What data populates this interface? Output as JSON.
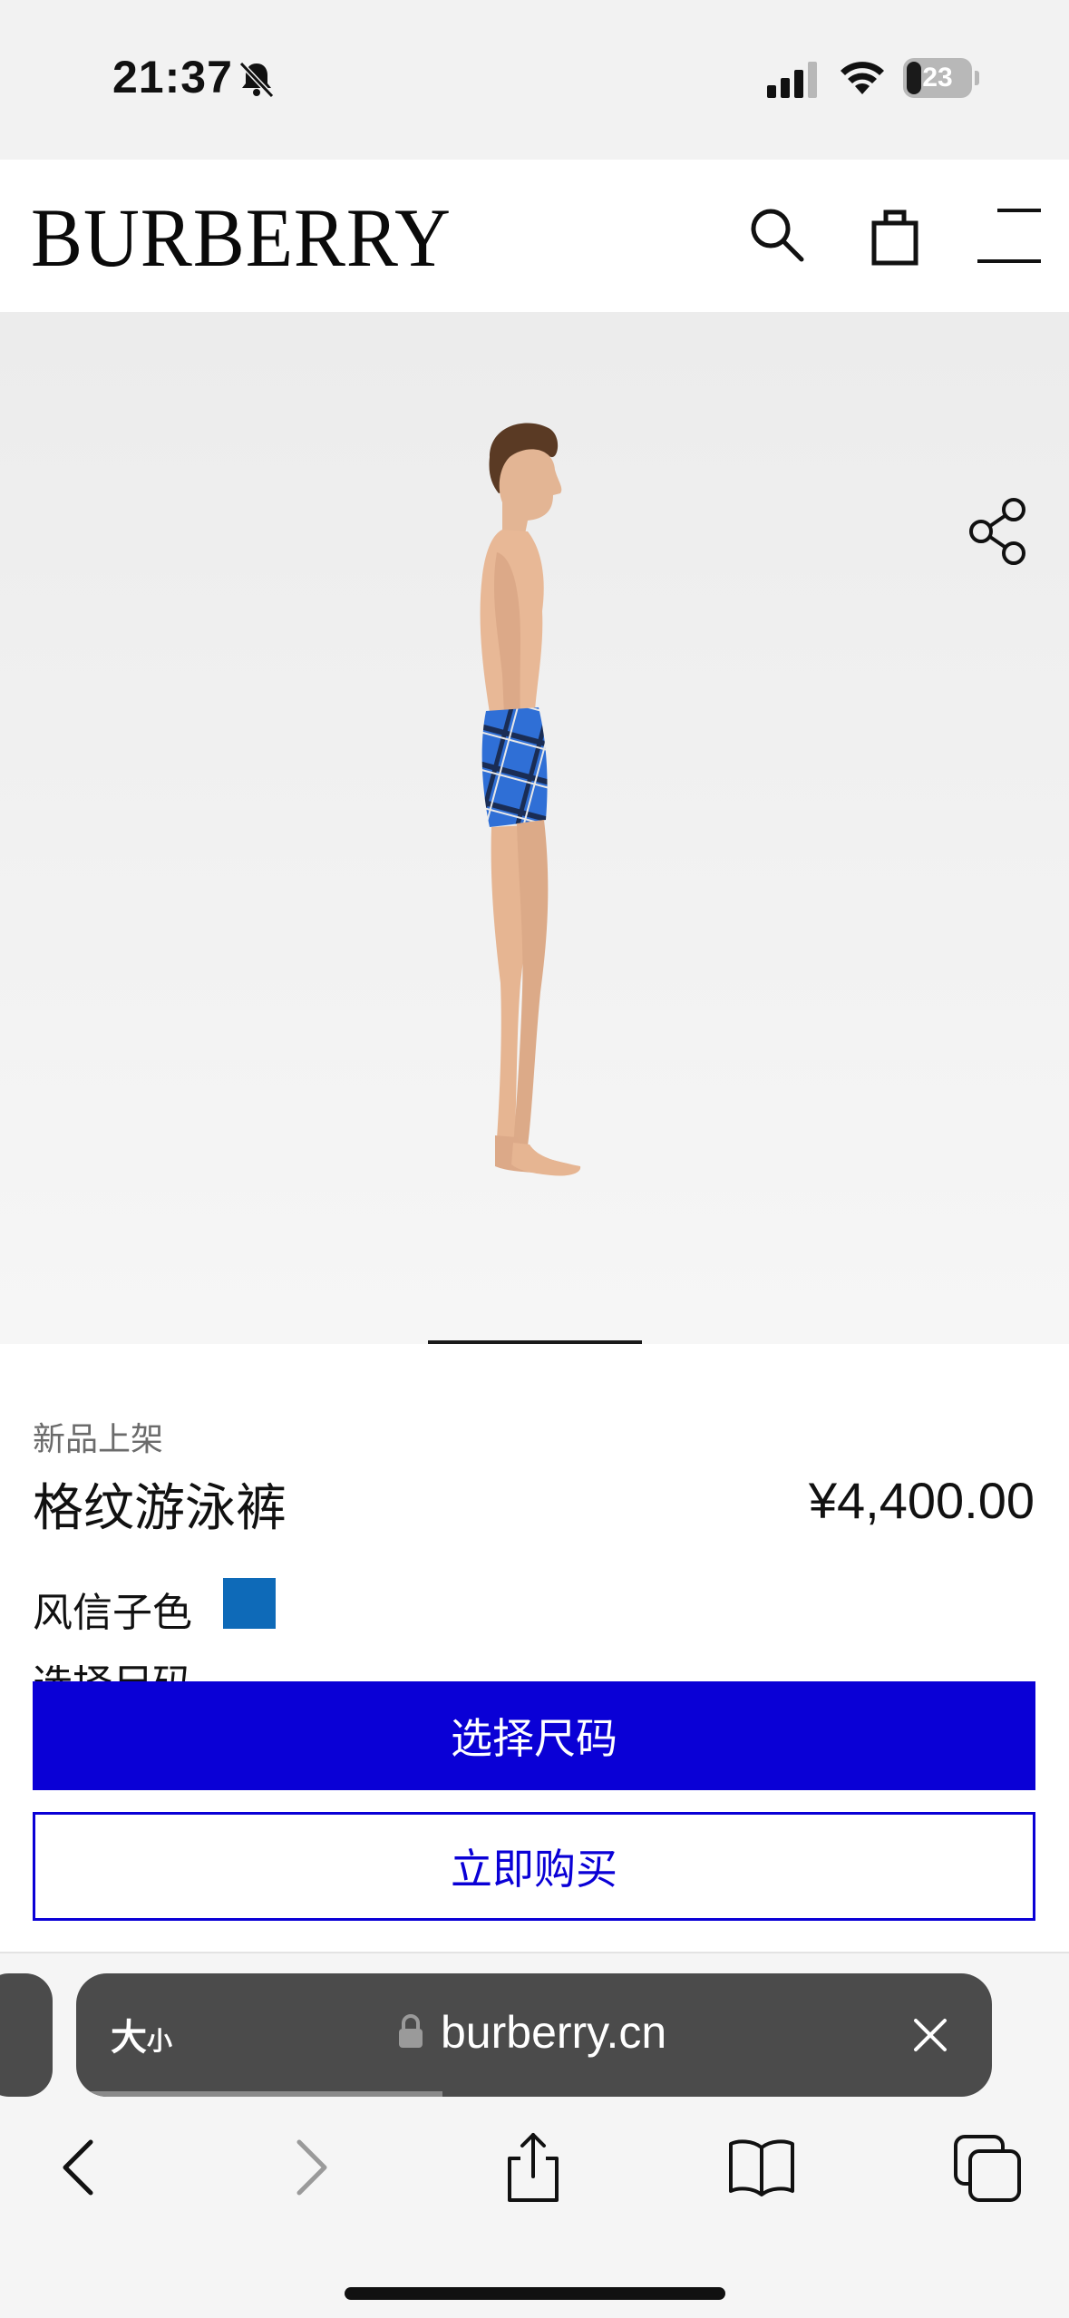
{
  "status_bar": {
    "time": "21:37",
    "battery": "23",
    "icons": [
      "bell-slash-icon",
      "cellular-signal-icon",
      "wifi-icon",
      "battery-icon"
    ]
  },
  "header": {
    "logo": "BURBERRY",
    "icons": [
      "search-icon",
      "shopping-bag-icon",
      "menu-icon"
    ]
  },
  "product_image": {
    "icons": [
      "share-icon"
    ],
    "swimwear_color": "#2f6fd6"
  },
  "product": {
    "badge": "新品上架",
    "name": "格纹游泳裤",
    "price": "¥4,400.00",
    "color_label": "风信子色",
    "swatch_color": "#0e6ab8",
    "size_label": "选择尺码"
  },
  "actions": {
    "select_size": "选择尺码",
    "buy_now": "立即购买",
    "accent_color": "#0a00d6"
  },
  "browser": {
    "text_size": "大",
    "text_size_small": "小",
    "url": "burberry.cn",
    "icons": [
      "lock-icon",
      "close-icon",
      "back-icon",
      "forward-icon",
      "share-icon",
      "bookmarks-icon",
      "tabs-icon"
    ]
  }
}
